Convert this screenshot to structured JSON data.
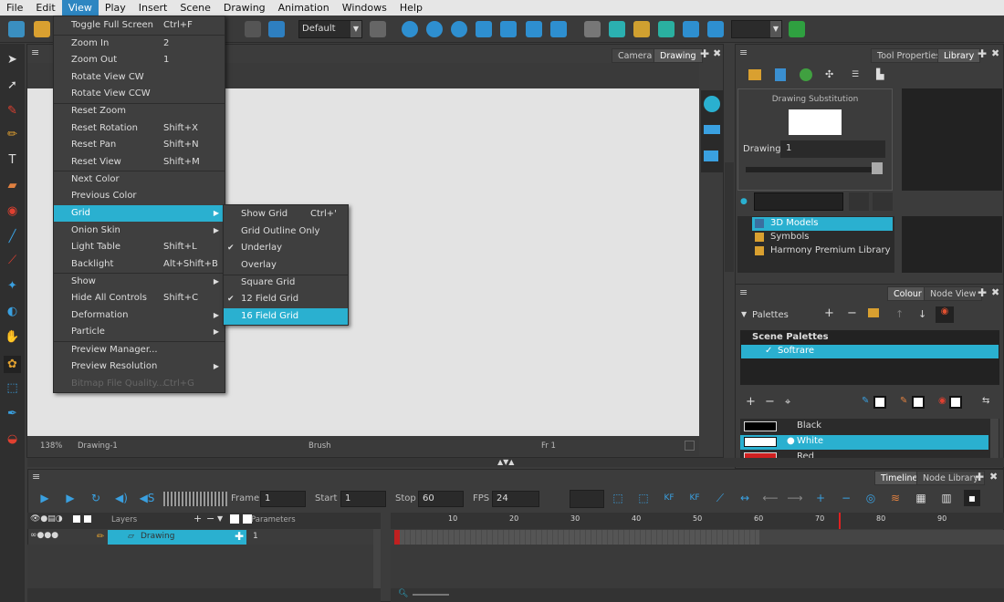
{
  "menubar": {
    "items": [
      "File",
      "Edit",
      "View",
      "Play",
      "Insert",
      "Scene",
      "Drawing",
      "Animation",
      "Windows",
      "Help"
    ],
    "active": "View"
  },
  "toolbar": {
    "workspace_value": "Default"
  },
  "drawing_panel": {
    "tabs": [
      "Camera",
      "Drawing"
    ],
    "status_zoom": "138%",
    "status_drawing": "Drawing-1",
    "status_tool": "Brush",
    "status_frame": "Fr 1"
  },
  "view_menu": {
    "items": [
      {
        "label": "Toggle Full Screen",
        "shortcut": "Ctrl+F"
      },
      {
        "label": "Zoom In",
        "shortcut": "2"
      },
      {
        "label": "Zoom Out",
        "shortcut": "1"
      },
      {
        "label": "Rotate View CW",
        "shortcut": ""
      },
      {
        "label": "Rotate View CCW",
        "shortcut": ""
      },
      {
        "label": "Reset Zoom",
        "shortcut": ""
      },
      {
        "label": "Reset Rotation",
        "shortcut": "Shift+X"
      },
      {
        "label": "Reset Pan",
        "shortcut": "Shift+N"
      },
      {
        "label": "Reset View",
        "shortcut": "Shift+M"
      },
      {
        "label": "Next Color",
        "shortcut": ""
      },
      {
        "label": "Previous Color",
        "shortcut": ""
      },
      {
        "label": "Grid",
        "shortcut": ""
      },
      {
        "label": "Onion Skin",
        "shortcut": ""
      },
      {
        "label": "Light Table",
        "shortcut": "Shift+L"
      },
      {
        "label": "Backlight",
        "shortcut": "Alt+Shift+B"
      },
      {
        "label": "Show",
        "shortcut": ""
      },
      {
        "label": "Hide All Controls",
        "shortcut": "Shift+C"
      },
      {
        "label": "Deformation",
        "shortcut": ""
      },
      {
        "label": "Particle",
        "shortcut": ""
      },
      {
        "label": "Preview Manager...",
        "shortcut": ""
      },
      {
        "label": "Preview Resolution",
        "shortcut": ""
      },
      {
        "label": "Bitmap File Quality...",
        "shortcut": "Ctrl+G"
      }
    ]
  },
  "grid_submenu": {
    "items": [
      {
        "label": "Show Grid",
        "shortcut": "Ctrl+'"
      },
      {
        "label": "Grid Outline Only",
        "shortcut": ""
      },
      {
        "label": "Underlay",
        "shortcut": ""
      },
      {
        "label": "Overlay",
        "shortcut": ""
      },
      {
        "label": "Square Grid",
        "shortcut": ""
      },
      {
        "label": "12 Field Grid",
        "shortcut": ""
      },
      {
        "label": "16 Field Grid",
        "shortcut": ""
      }
    ]
  },
  "library_panel": {
    "tabs": [
      "Tool Properties",
      "Library"
    ],
    "substitution_title": "Drawing Substitution",
    "drawing_label": "Drawing",
    "drawing_value": "1",
    "tree": [
      "3D Models",
      "Symbols",
      "Harmony Premium Library"
    ]
  },
  "colour_panel": {
    "tabs": [
      "Colour",
      "Node View"
    ],
    "palettes_label": "Palettes",
    "scene_palettes_header": "Scene Palettes",
    "palette_selected": "Softrare",
    "swatches": [
      {
        "name": "Black",
        "color": "#000000"
      },
      {
        "name": "White",
        "color": "#ffffff"
      },
      {
        "name": "Red",
        "color": "#d02020"
      }
    ]
  },
  "timeline": {
    "tabs": [
      "Timeline",
      "Node Library"
    ],
    "frame_label": "Frame",
    "frame_value": "1",
    "start_label": "Start",
    "start_value": "1",
    "stop_label": "Stop",
    "stop_value": "60",
    "fps_label": "FPS",
    "fps_value": "24",
    "layers_header": "Layers",
    "parameters_header": "Parameters",
    "layer_name": "Drawing",
    "layer_param": "1",
    "ruler": [
      "10",
      "20",
      "30",
      "40",
      "50",
      "60",
      "70",
      "80",
      "90"
    ]
  }
}
